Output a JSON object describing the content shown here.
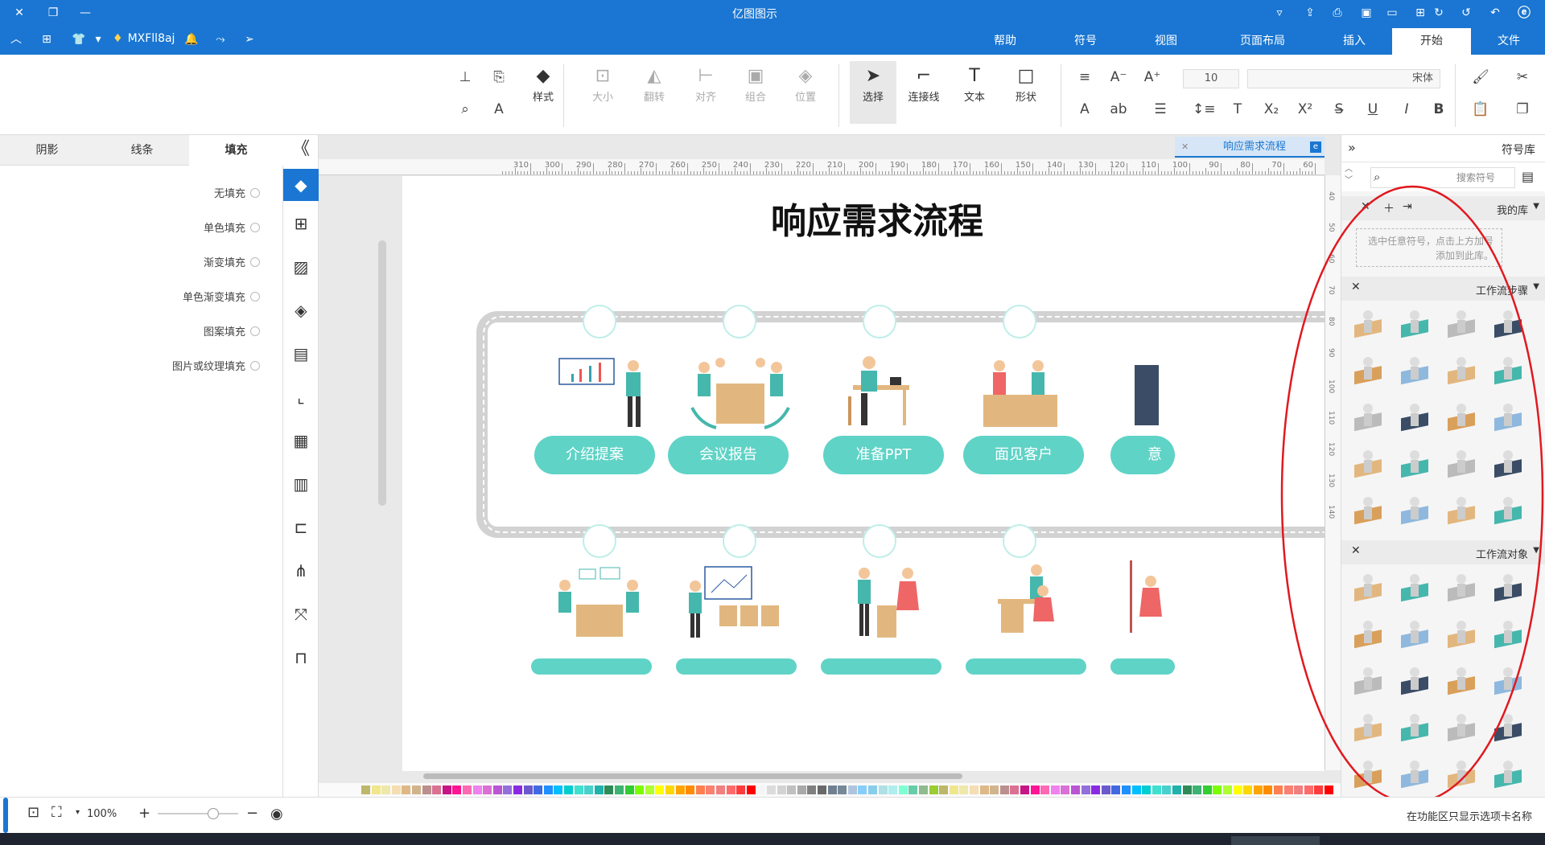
{
  "window": {
    "title": "亿图图示"
  },
  "menu": {
    "tabs": [
      "文件",
      "开始",
      "插入",
      "页面布局",
      "视图",
      "符号",
      "帮助"
    ],
    "active_tab": "开始",
    "user": "MXFll8aj"
  },
  "ribbon": {
    "font_name": "宋体",
    "font_size": "10",
    "tools": {
      "shape": "形状",
      "text": "文本",
      "connector": "连接线",
      "select": "选择"
    },
    "disabled": {
      "position": "位置",
      "group": "组合",
      "align": "对齐",
      "rotate": "翻转",
      "size": "大小"
    },
    "style": "样式"
  },
  "left_panel": {
    "tabs": [
      "填充",
      "线条",
      "阴影"
    ],
    "options": [
      "无填充",
      "单色填充",
      "渐变填充",
      "单色渐变填充",
      "图案填充",
      "图片或纹理填充"
    ]
  },
  "canvas": {
    "doc_tab": "响应需求流程",
    "ruler_labels": [
      "60",
      "70",
      "80",
      "90",
      "100",
      "110",
      "120",
      "130",
      "140",
      "150",
      "160",
      "170",
      "180",
      "190",
      "200",
      "210",
      "220",
      "230",
      "240",
      "250",
      "260",
      "270",
      "280",
      "290",
      "300",
      "310"
    ],
    "ruler_left_labels": [
      "40",
      "50",
      "60",
      "70",
      "80",
      "90",
      "100",
      "110",
      "120",
      "130",
      "140"
    ],
    "title": "响应需求流程",
    "steps_top": [
      "面见客户",
      "准备PPT",
      "会议报告",
      "介绍提案"
    ],
    "partial_label": "意"
  },
  "right_panel": {
    "header": "符号库",
    "search_placeholder": "搜索符号",
    "my_library": "我的库",
    "my_library_hint": "选中任意符号，点击上方加号添加到此库。",
    "section1": "工作流步骤",
    "section2": "工作流对象"
  },
  "status": {
    "hint": "在功能区只显示选项卡名称",
    "zoom": "100%"
  },
  "colors": {
    "titlebar": "#1a76d2",
    "teal": "#5fd3c6",
    "road": "#cfcfcf",
    "annotation": "#e0191f"
  }
}
